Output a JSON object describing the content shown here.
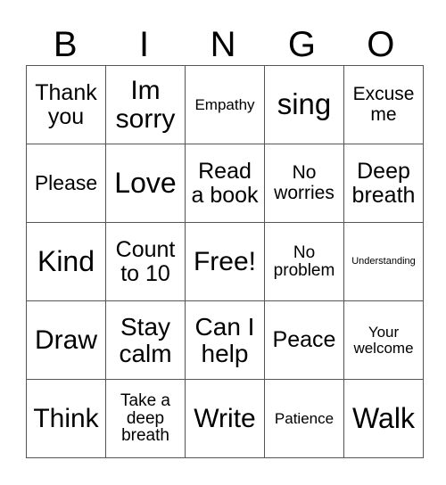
{
  "header": {
    "letters": [
      "B",
      "I",
      "N",
      "G",
      "O"
    ]
  },
  "grid": {
    "rows": [
      [
        "Thank\nyou",
        "Im\nsorry",
        "Empathy",
        "sing",
        "Excuse\nme"
      ],
      [
        "Please",
        "Love",
        "Read\na book",
        "No\nworries",
        "Deep\nbreath"
      ],
      [
        "Kind",
        "Count\nto 10",
        "Free!",
        "No\nproblem",
        "Understanding"
      ],
      [
        "Draw",
        "Stay\ncalm",
        "Can I\nhelp",
        "Peace",
        "Your\nwelcome"
      ],
      [
        "Think",
        "Take a\ndeep\nbreath",
        "Write",
        "Patience",
        "Walk"
      ]
    ]
  }
}
